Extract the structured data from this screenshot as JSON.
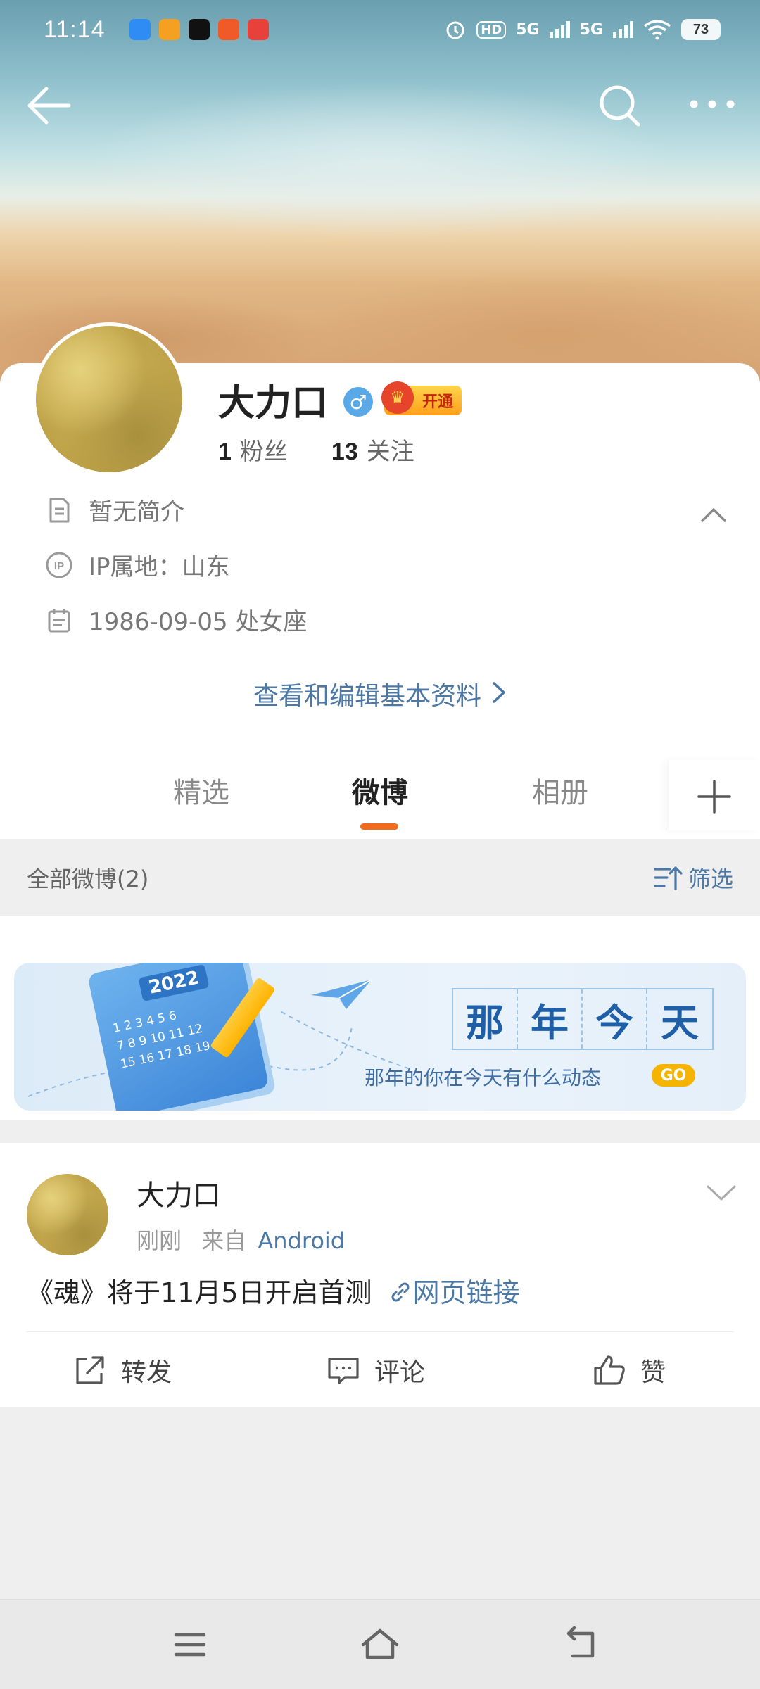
{
  "status_bar": {
    "time": "11:14",
    "hd_label": "HD",
    "net1": "5G",
    "net2": "5G",
    "battery": "73",
    "app_icon_colors": [
      "#2f8cf5",
      "#f5a020",
      "#111111",
      "#f05a28",
      "#e8413c"
    ]
  },
  "profile": {
    "name": "大力口",
    "gender_symbol": "♂",
    "vip_label": "开通",
    "fans_count": "1",
    "fans_label": "粉丝",
    "follow_count": "13",
    "follow_label": "关注",
    "bio": "暂无简介",
    "ip_location": "IP属地：山东",
    "birthday": "1986-09-05 处女座",
    "edit_link": "查看和编辑基本资料"
  },
  "tabs": [
    {
      "label": "精选",
      "active": false
    },
    {
      "label": "微博",
      "active": true
    },
    {
      "label": "相册",
      "active": false
    }
  ],
  "filter": {
    "title": "全部微博(2)",
    "button": "筛选"
  },
  "banner": {
    "year": "2022",
    "title_chars": [
      "那",
      "年",
      "今",
      "天"
    ],
    "subtitle": "那年的你在今天有什么动态",
    "go_label": "GO"
  },
  "post": {
    "author": "大力口",
    "time": "刚刚",
    "source_prefix": "来自",
    "source": "Android",
    "text": "《魂》将于11月5日开启首测",
    "link_text": "网页链接",
    "actions": {
      "repost": "转发",
      "comment": "评论",
      "like": "赞"
    }
  },
  "colors": {
    "accent": "#f26b1d",
    "link": "#4c78a6"
  }
}
